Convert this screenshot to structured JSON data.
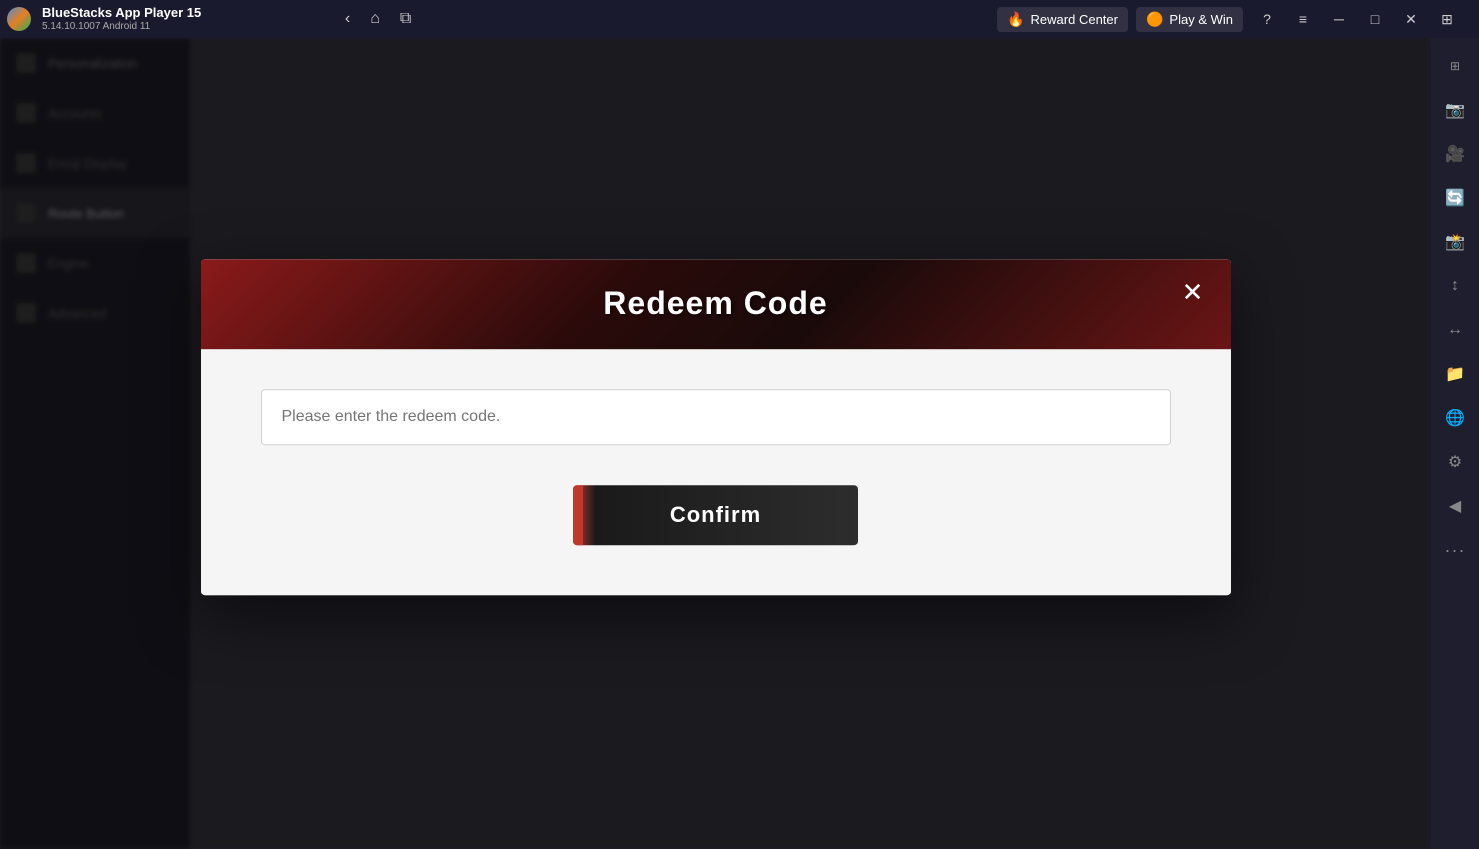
{
  "titleBar": {
    "appName": "BlueStacks App Player 15",
    "appVersion": "5.14.10.1007  Android 11",
    "navButtons": {
      "back": "‹",
      "home": "⌂",
      "tabs": "⧉"
    },
    "rewardCenter": {
      "label": "Reward Center",
      "icon": "🔥"
    },
    "playWin": {
      "label": "Play & Win",
      "icon": "🟠"
    },
    "controls": {
      "help": "?",
      "menu": "≡",
      "minimize": "─",
      "maximize": "□",
      "close": "✕",
      "snap": "⊞"
    }
  },
  "dialog": {
    "title": "Redeem Code",
    "closeIcon": "✕",
    "input": {
      "placeholder": "Please enter the redeem code.",
      "value": ""
    },
    "confirmButton": "Confirm"
  },
  "sidebar": {
    "icons": [
      "📷",
      "🎥",
      "🔄",
      "📸",
      "↕",
      "↔",
      "📁",
      "🌐",
      "⚙",
      "◀",
      "▼",
      "•••"
    ]
  }
}
